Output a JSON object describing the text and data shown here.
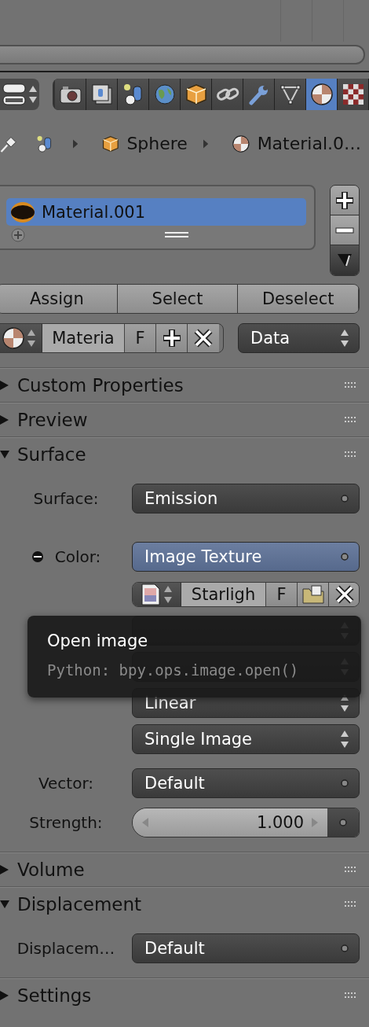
{
  "tabs": [
    {
      "kind": "render",
      "selected": false
    },
    {
      "kind": "render_layers",
      "selected": false
    },
    {
      "kind": "scene",
      "selected": false
    },
    {
      "kind": "world",
      "selected": false
    },
    {
      "kind": "object",
      "selected": false
    },
    {
      "kind": "constraints",
      "selected": false
    },
    {
      "kind": "modifiers",
      "selected": false
    },
    {
      "kind": "data",
      "selected": false
    },
    {
      "kind": "material",
      "selected": true
    },
    {
      "kind": "texture",
      "selected": false
    }
  ],
  "breadcrumb": [
    {
      "kind": "scene"
    },
    {
      "kind": "object",
      "label": "Sphere"
    },
    {
      "kind": "material",
      "label": "Material.0…"
    }
  ],
  "material_slots": [
    {
      "name": "Material.001",
      "selected": true
    }
  ],
  "slot_actions": [
    "Assign",
    "Select",
    "Deselect"
  ],
  "material_selector": {
    "name": "Materia",
    "fake_user": "F"
  },
  "link": "Data",
  "panels": [
    {
      "title": "Custom Properties",
      "expanded": false
    },
    {
      "title": "Preview",
      "expanded": false
    },
    {
      "title": "Surface",
      "expanded": true,
      "rows": [
        {
          "kind": "socket",
          "label": "Surface:",
          "value": "Emission",
          "linked": false
        },
        {
          "kind": "socket",
          "label": "Color:",
          "value": "Image Texture",
          "linked": true,
          "open": true
        },
        {
          "kind": "image",
          "name": "Starligh",
          "fake_user": "F"
        },
        {
          "kind": "enum"
        },
        {
          "kind": "enum"
        },
        {
          "kind": "enum",
          "value": "Linear"
        },
        {
          "kind": "enum",
          "value": "Single Image"
        },
        {
          "kind": "socket",
          "label": "Vector:",
          "value": "Default",
          "linked": false
        },
        {
          "kind": "number",
          "label": "Strength:",
          "value": "1.000"
        }
      ]
    },
    {
      "title": "Volume",
      "expanded": false
    },
    {
      "title": "Displacement",
      "expanded": true,
      "rows": [
        {
          "kind": "socket",
          "label": "Displacem…",
          "value": "Default",
          "linked": false
        }
      ]
    },
    {
      "title": "Settings",
      "expanded": false
    }
  ],
  "tooltip": {
    "title": "Open image",
    "python": "Python: bpy.ops.image.open()"
  }
}
